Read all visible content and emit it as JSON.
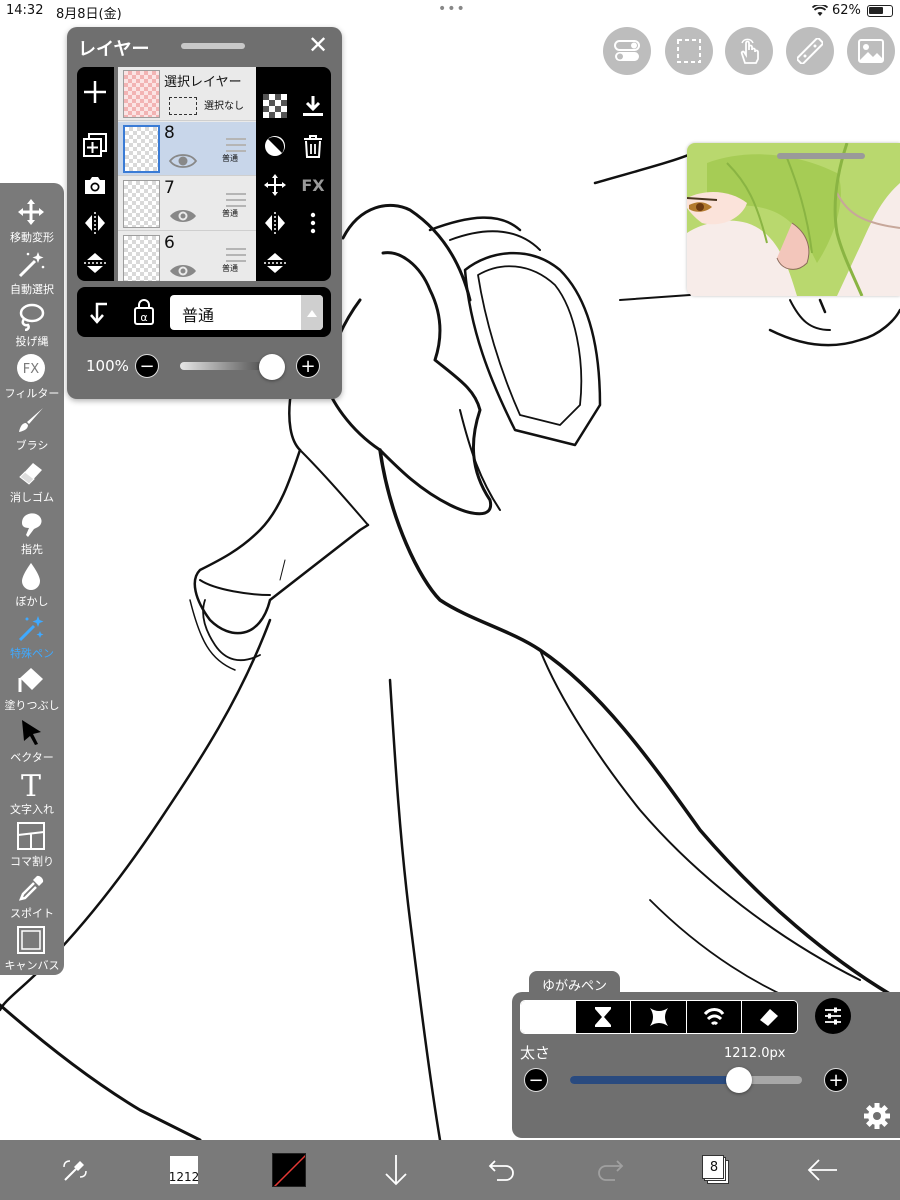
{
  "status_bar": {
    "time": "14:32",
    "date": "8月8日(金)",
    "battery": "62%"
  },
  "left_toolbar": {
    "tools": [
      {
        "label": "移動変形",
        "icon": "move-transform-icon"
      },
      {
        "label": "自動選択",
        "icon": "magic-wand-icon"
      },
      {
        "label": "投げ縄",
        "icon": "lasso-icon"
      },
      {
        "label": "フィルター",
        "icon": "fx-icon"
      },
      {
        "label": "ブラシ",
        "icon": "brush-icon"
      },
      {
        "label": "消しゴム",
        "icon": "eraser-icon"
      },
      {
        "label": "指先",
        "icon": "smudge-icon"
      },
      {
        "label": "ぼかし",
        "icon": "blur-drop-icon"
      },
      {
        "label": "特殊ペン",
        "icon": "special-pen-icon",
        "active": true
      },
      {
        "label": "塗りつぶし",
        "icon": "fill-bucket-icon"
      },
      {
        "label": "ベクター",
        "icon": "vector-cursor-icon"
      },
      {
        "label": "文字入れ",
        "icon": "text-icon"
      },
      {
        "label": "コマ割り",
        "icon": "frame-divider-icon"
      },
      {
        "label": "スポイト",
        "icon": "eyedropper-icon"
      },
      {
        "label": "キャンバス",
        "icon": "canvas-icon"
      }
    ]
  },
  "layer_panel": {
    "title": "レイヤー",
    "layers": [
      {
        "name": "選択レイヤー",
        "sub": "選択なし",
        "type": "selection"
      },
      {
        "name": "8",
        "blend": "普通",
        "selected": true
      },
      {
        "name": "7",
        "blend": "普通"
      },
      {
        "name": "6",
        "blend": "普通"
      }
    ],
    "blend_mode": "普通",
    "opacity": "100%",
    "opacity_value": 1.0,
    "alpha_lock": "α",
    "fx_label": "FX"
  },
  "brush_panel": {
    "tab_label": "ゆがみペン",
    "modes": [
      "moon-icon",
      "hourglass-icon",
      "pinch-icon",
      "swirl-icon",
      "eraser-icon"
    ],
    "active_mode": 0,
    "size_label": "太さ",
    "size_value": "1212.0px",
    "size_fraction": 0.73
  },
  "bottom_bar": {
    "brush_size": "1212",
    "layer_count": "8"
  },
  "colors": {
    "toolbar_gray": "#7a7a7a",
    "panel_gray": "#6f6f6f",
    "active_tool": "#3fa9ff",
    "slider_fill": "#294a7f"
  }
}
